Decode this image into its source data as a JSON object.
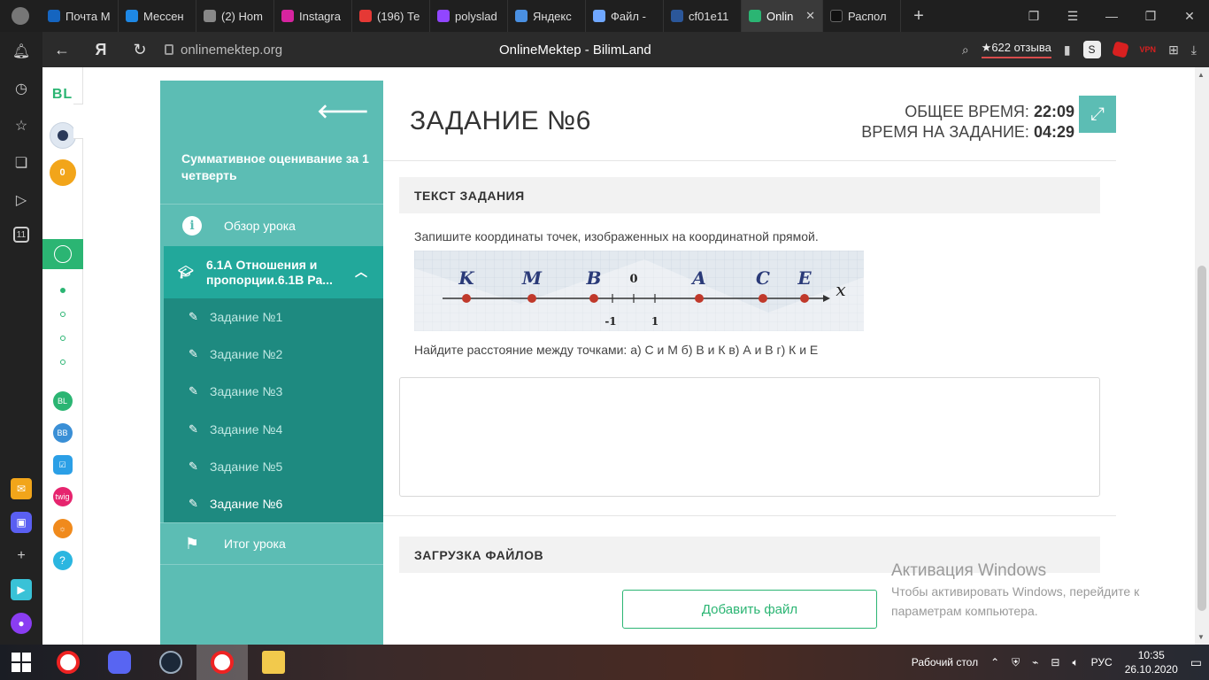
{
  "browser": {
    "tabs": [
      {
        "label": "Почта М",
        "color": "#1565c0"
      },
      {
        "label": "Мессен",
        "color": "#1e88e5"
      },
      {
        "label": "(2) Hom",
        "color": "#888888"
      },
      {
        "label": "Instagra",
        "color": "#d6249f"
      },
      {
        "label": "(196) Те",
        "color": "#e53935"
      },
      {
        "label": "polyslad",
        "color": "#9146ff"
      },
      {
        "label": "Яндекс",
        "color": "#4a90e2"
      },
      {
        "label": "Файл -",
        "color": "#6fa7ff"
      },
      {
        "label": "cf01e11",
        "color": "#2b579a"
      },
      {
        "label": "Onlin",
        "color": "#2bb573",
        "active": true
      },
      {
        "label": "Распол",
        "color": "#111111"
      }
    ],
    "url": "onlinemektep.org",
    "page_title": "OnlineMektep - BilimLand",
    "reviews": "★622 отзыва"
  },
  "site": {
    "logo": "BL",
    "coins": "0"
  },
  "lesson": {
    "title": "Суммативное оценивание за 1 четверть",
    "overview_label": "Обзор урока",
    "module_label": "6.1А Отношения и пропорции.6.1В Ра...",
    "tasks": [
      "Задание №1",
      "Задание №2",
      "Задание №3",
      "Задание №4",
      "Задание №5",
      "Задание №6"
    ],
    "summary_label": "Итог урока"
  },
  "main": {
    "task_title": "ЗАДАНИЕ №6",
    "total_time_label": "ОБЩЕЕ ВРЕМЯ:",
    "total_time": "22:09",
    "task_time_label": "ВРЕМЯ НА ЗАДАНИЕ:",
    "task_time": "04:29",
    "section_text": "ТЕКСТ ЗАДАНИЯ",
    "instruction": "Запишите координаты точек, изображенных на координатной прямой.",
    "question": "Найдите расстояние между точками: а) С и М б) В и К в) А и В г) К и Е",
    "section_upload": "ЗАГРУЗКА ФАЙЛОВ",
    "add_file": "Добавить файл"
  },
  "numberline": {
    "points": [
      "K",
      "M",
      "B",
      "A",
      "C",
      "E"
    ],
    "zero": "0",
    "minus_one": "-1",
    "one": "1",
    "axis": "x",
    "point_color": "#c0392b"
  },
  "windows": {
    "activation_title": "Активация Windows",
    "activation_text_1": "Чтобы активировать Windows, перейдите к",
    "activation_text_2": "параметрам компьютера."
  },
  "taskbar": {
    "desktop_label": "Рабочий стол",
    "language": "РУС",
    "time": "10:35",
    "date": "26.10.2020"
  }
}
